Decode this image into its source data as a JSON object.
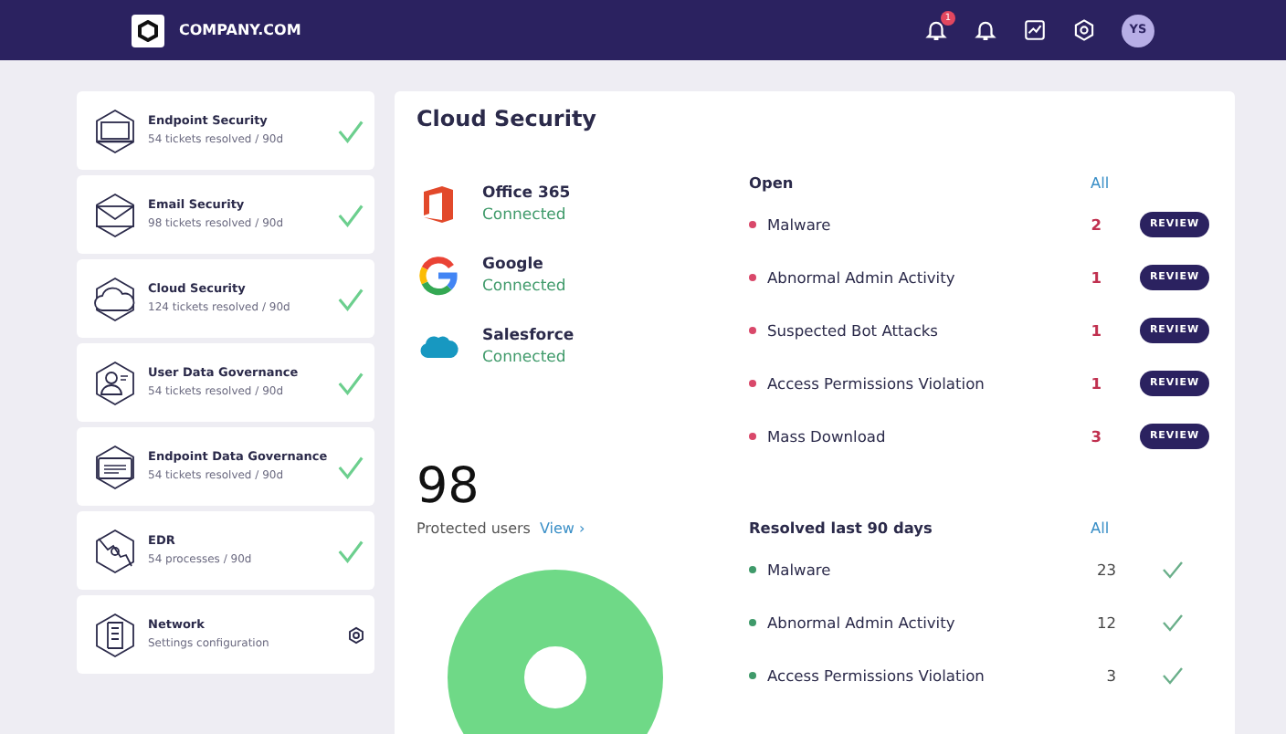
{
  "navbar": {
    "brand": "COMPANY.COM",
    "notification_badge": "1",
    "avatar": "YS"
  },
  "sidebar": {
    "items": [
      {
        "title": "Endpoint Security",
        "subtitle": "54 tickets resolved / 90d",
        "kind": "check"
      },
      {
        "title": "Email Security",
        "subtitle": "98 tickets resolved / 90d",
        "kind": "check"
      },
      {
        "title": "Cloud Security",
        "subtitle": "124 tickets resolved / 90d",
        "kind": "check"
      },
      {
        "title": "User Data Governance",
        "subtitle": "54 tickets resolved / 90d",
        "kind": "check"
      },
      {
        "title": "Endpoint Data Governance",
        "subtitle": "54 tickets resolved / 90d",
        "kind": "check"
      },
      {
        "title": "EDR",
        "subtitle": "54 processes / 90d",
        "kind": "check"
      },
      {
        "title": "Network",
        "subtitle": "Settings configuration",
        "kind": "settings"
      }
    ]
  },
  "panel": {
    "title": "Cloud Security",
    "integrations": [
      {
        "name": "Office 365",
        "status": "Connected"
      },
      {
        "name": "Google",
        "status": "Connected"
      },
      {
        "name": "Salesforce",
        "status": "Connected"
      }
    ],
    "protected_users": {
      "count": "98",
      "label": "Protected users",
      "link": "View ›"
    },
    "open": {
      "heading": "Open",
      "all_link": "All",
      "items": [
        {
          "name": "Malware",
          "count": "2",
          "action": "REVIEW"
        },
        {
          "name": "Abnormal Admin Activity",
          "count": "1",
          "action": "REVIEW"
        },
        {
          "name": "Suspected Bot Attacks",
          "count": "1",
          "action": "REVIEW"
        },
        {
          "name": "Access Permissions Violation",
          "count": "1",
          "action": "REVIEW"
        },
        {
          "name": "Mass Download",
          "count": "3",
          "action": "REVIEW"
        }
      ]
    },
    "resolved": {
      "heading": "Resolved last 90 days",
      "all_link": "All",
      "items": [
        {
          "name": "Malware",
          "count": "23"
        },
        {
          "name": "Abnormal Admin Activity",
          "count": "12"
        },
        {
          "name": "Access Permissions Violation",
          "count": "3"
        }
      ]
    }
  }
}
